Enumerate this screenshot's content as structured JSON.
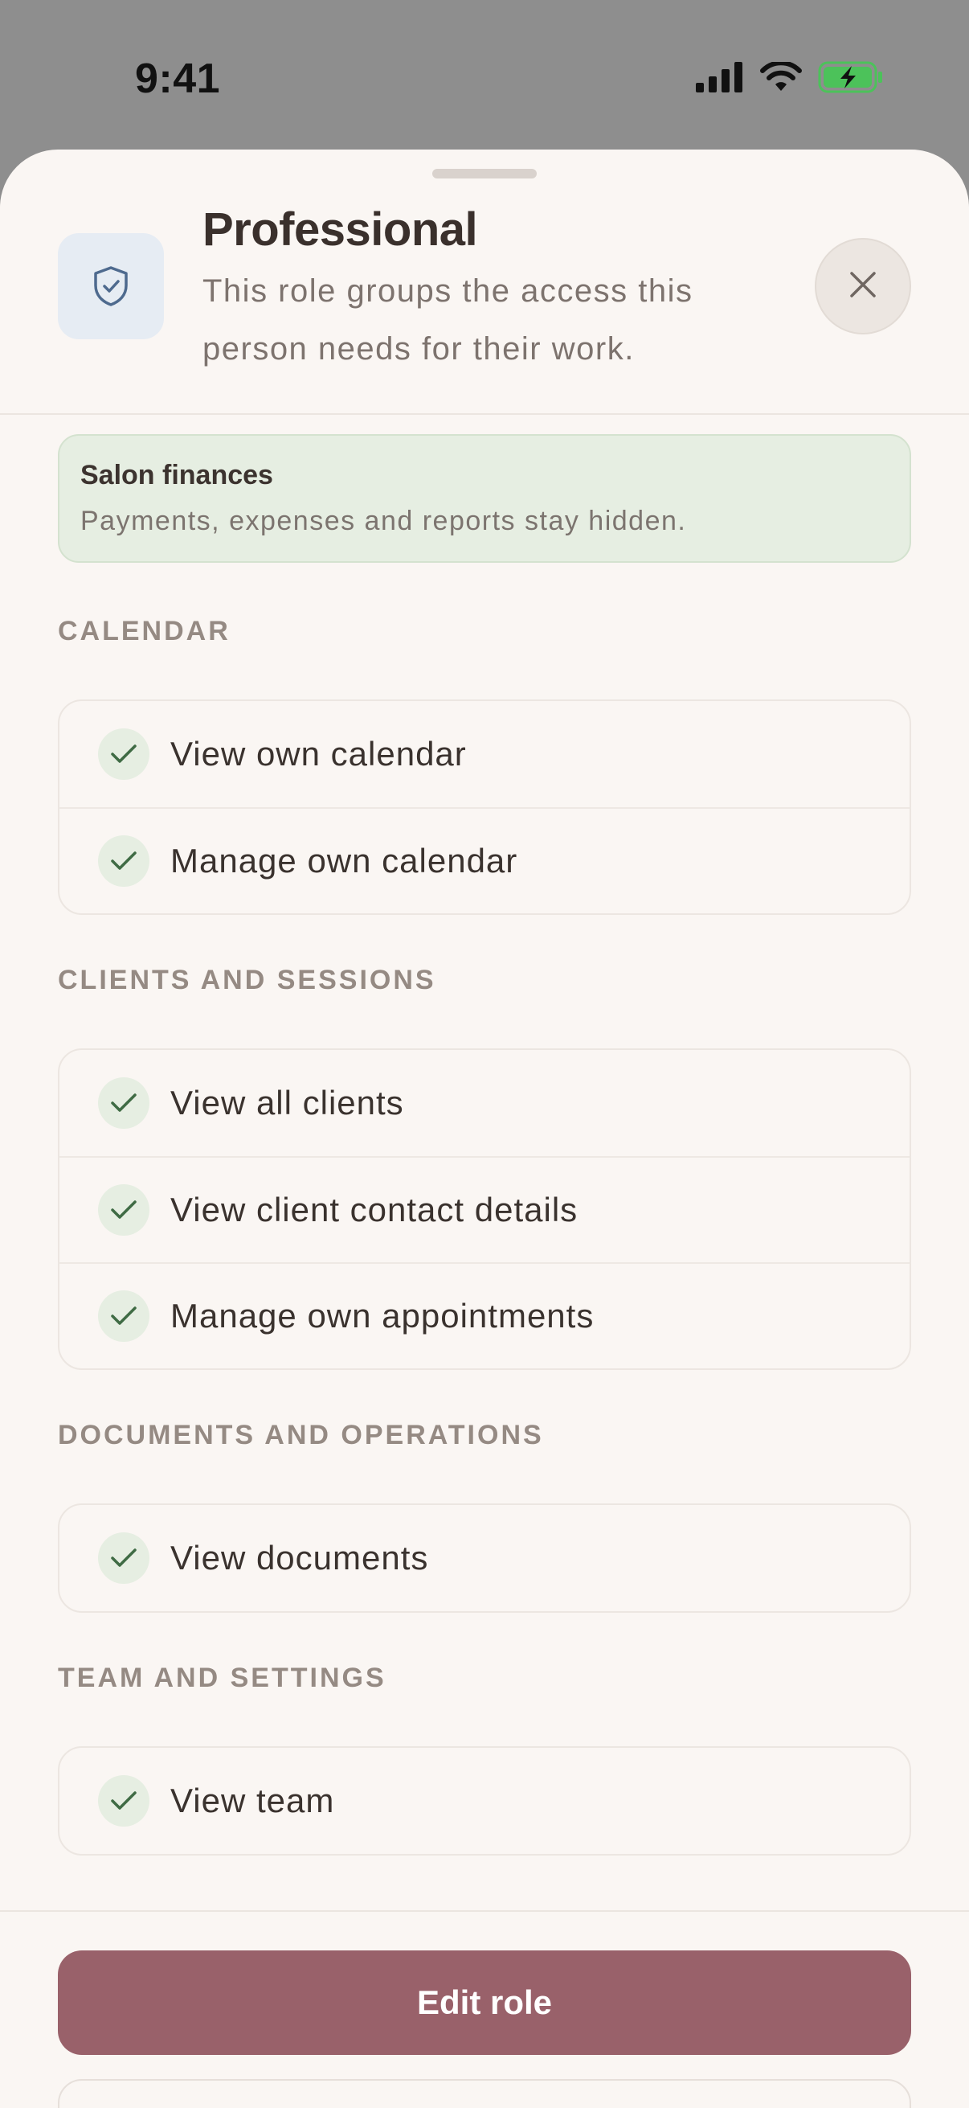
{
  "status_bar": {
    "time": "9:41"
  },
  "header": {
    "title": "Professional",
    "description": "This role groups the access this person needs for their work."
  },
  "notice": {
    "title": "Salon finances",
    "text": "Payments, expenses and reports stay hidden."
  },
  "sections": [
    {
      "label": "CALENDAR",
      "items": [
        "View own calendar",
        "Manage own calendar"
      ]
    },
    {
      "label": "CLIENTS AND SESSIONS",
      "items": [
        "View all clients",
        "View client contact details",
        "Manage own appointments"
      ]
    },
    {
      "label": "DOCUMENTS AND OPERATIONS",
      "items": [
        "View documents"
      ]
    },
    {
      "label": "TEAM AND SETTINGS",
      "items": [
        "View team"
      ]
    }
  ],
  "actions": {
    "edit_label": "Edit role"
  },
  "colors": {
    "accent": "#99616a",
    "check_bg": "#e6eee2",
    "check_stroke": "#3f6b44",
    "battery": "#4cc25a"
  },
  "icons": [
    "signal-icon",
    "wifi-icon",
    "battery-icon",
    "shield-check-icon",
    "close-icon",
    "check-icon"
  ]
}
